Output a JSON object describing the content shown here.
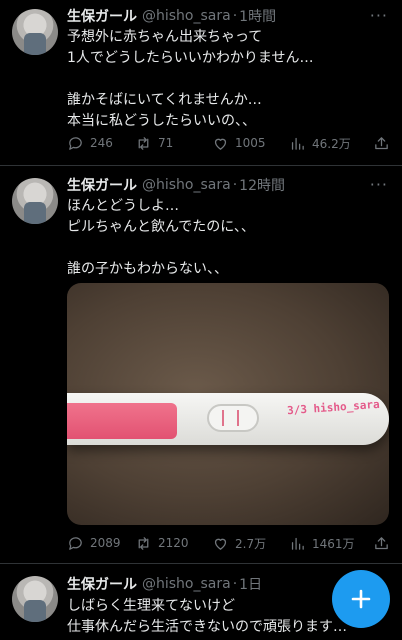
{
  "tweets": [
    {
      "display_name": "生保ガール",
      "handle": "@hisho_sara",
      "time": "1時間",
      "lines": [
        "予想外に赤ちゃん出来ちゃって",
        "1人でどうしたらいいかわかりません…",
        "",
        "誰かそばにいてくれませんか…",
        "本当に私どうしたらいいの、、"
      ],
      "replies": "246",
      "retweets": "71",
      "likes": "1005",
      "views": "46.2万"
    },
    {
      "display_name": "生保ガール",
      "handle": "@hisho_sara",
      "time": "12時間",
      "lines": [
        "ほんとどうしよ…",
        "ピルちゃんと飲んでたのに、、",
        "",
        "誰の子かもわからない、、"
      ],
      "image_label": "3/3 hisho_sara",
      "replies": "2089",
      "retweets": "2120",
      "likes": "2.7万",
      "views": "1461万"
    },
    {
      "display_name": "生保ガール",
      "handle": "@hisho_sara",
      "time": "1日",
      "lines": [
        "しばらく生理来てないけど",
        "仕事休んだら生活できないので頑張ります…"
      ]
    }
  ],
  "separator": "·",
  "more_glyph": "···",
  "icons": {
    "reply": "reply-icon",
    "retweet": "retweet-icon",
    "like": "heart-icon",
    "views": "views-icon",
    "share": "share-icon",
    "compose": "plus-icon"
  },
  "colors": {
    "accent": "#1d9bf0",
    "muted": "#71767b",
    "background": "#000000"
  }
}
